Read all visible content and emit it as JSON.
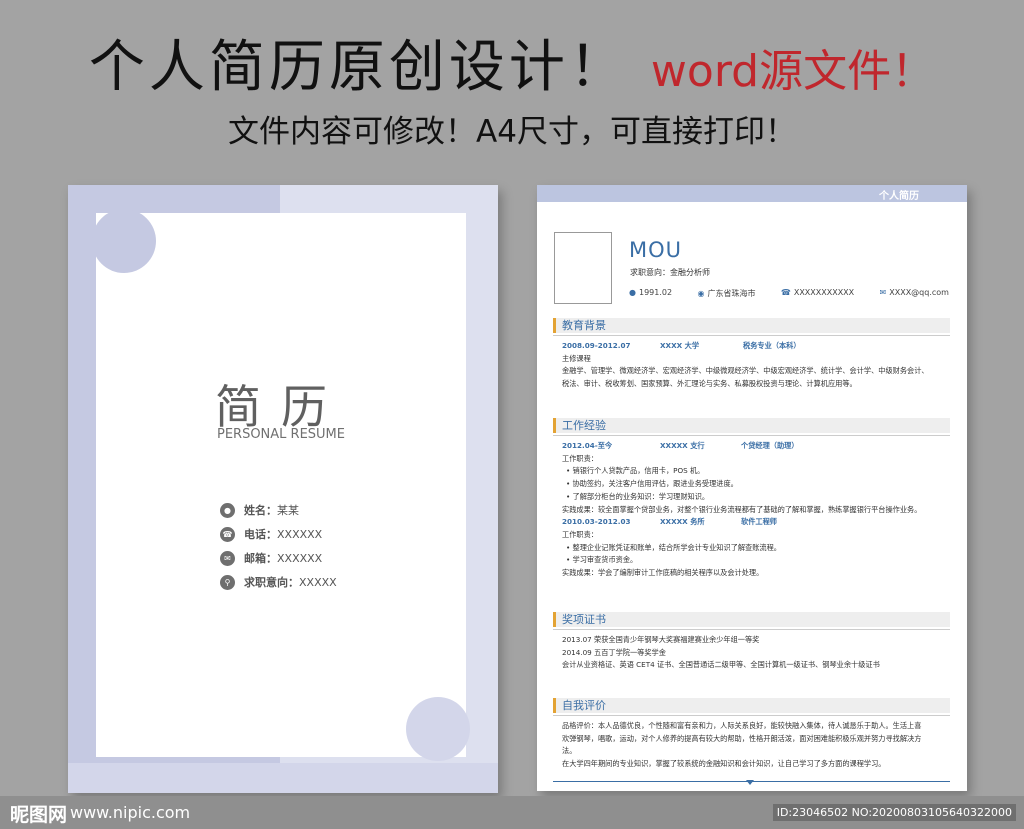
{
  "banner": {
    "headline": "个人简历原创设计！",
    "headline_red": "word源文件！",
    "subheadline": "文件内容可修改！A4尺寸，可直接打印！"
  },
  "cover": {
    "title": "简历",
    "subtitle": "PERSONAL RESUME",
    "fields": [
      {
        "label": "姓名：",
        "value": "某某",
        "icon": "person-icon"
      },
      {
        "label": "电话：",
        "value": "XXXXXX",
        "icon": "phone-icon"
      },
      {
        "label": "邮箱：",
        "value": "XXXXXX",
        "icon": "mail-icon"
      },
      {
        "label": "求职意向：",
        "value": "XXXXX",
        "icon": "search-icon"
      }
    ]
  },
  "resume": {
    "header_tag": "个人简历",
    "name": "MOU",
    "job_intention": "求职意向：金融分析师",
    "contacts": {
      "birth": "1991.02",
      "location": "广东省珠海市",
      "phone": "XXXXXXXXXXX",
      "email": "XXXX@qq.com"
    },
    "education": {
      "title": "教育背景",
      "period": "2008.09-2012.07",
      "school": "XXXX 大学",
      "major": "税务专业（本科）",
      "courses_label": "主修课程",
      "courses_1": "金融学、管理学、微观经济学、宏观经济学、中级微观经济学、中级宏观经济学、统计学、会计学、中级财务会计、",
      "courses_2": "税法、审计、税收筹划、国家预算、外汇理论与实务、私募股权投资与理论、计算机应用等。"
    },
    "work": {
      "title": "工作经验",
      "job1": {
        "period": "2012.04-至今",
        "company": "XXXXX 支行",
        "position": "个贷经理（助理）",
        "duties_label": "工作职责：",
        "duties": [
          "销银行个人贷款产品，信用卡，POS 机。",
          "协助签约，关注客户信用评估，跟进业务受理进度。",
          "了解部分柜台的业务知识：学习理财知识。"
        ],
        "result": "实践成果：较全面掌握个贷部业务，对整个银行业务流程都有了基础的了解和掌握，熟练掌握银行平台操作业务。"
      },
      "job2": {
        "period": "2010.03-2012.03",
        "company": "XXXXX 务所",
        "position": "软件工程师",
        "duties_label": "工作职责：",
        "duties": [
          "整理企业记账凭证和账单，结合所学会计专业知识了解查账流程。",
          "学习审查货币资金。"
        ],
        "result": "实践成果：学会了编制审计工作底稿的相关程序以及会计处理。"
      }
    },
    "awards": {
      "title": "奖项证书",
      "items": [
        "2013.07  荣获全国青少年钢琴大奖赛福建赛业余少年组一等奖",
        "2014.09  五百丁学院一等奖学金",
        "会计从业资格证、英语 CET4 证书、全国普通话二级甲等、全国计算机一级证书、钢琴业余十级证书"
      ]
    },
    "self": {
      "title": "自我评价",
      "lines": [
        "品格评价：本人品德优良，个性随和富有亲和力，人际关系良好，能较快融入集体，待人诚恳乐于助人。生活上喜",
        "欢弹钢琴，唱歌，运动，对个人修养的提高有较大的帮助，性格开朗活泼，面对困难能积极乐观并努力寻找解决方",
        "法。",
        "在大学四年期间的专业知识，掌握了较系统的金融知识和会计知识，让自己学习了多方面的课程学习。"
      ]
    }
  },
  "watermark": {
    "logo": "昵图网",
    "site": "www.nipic.com",
    "id": "ID:23046502 NO:20200803105640322000"
  }
}
